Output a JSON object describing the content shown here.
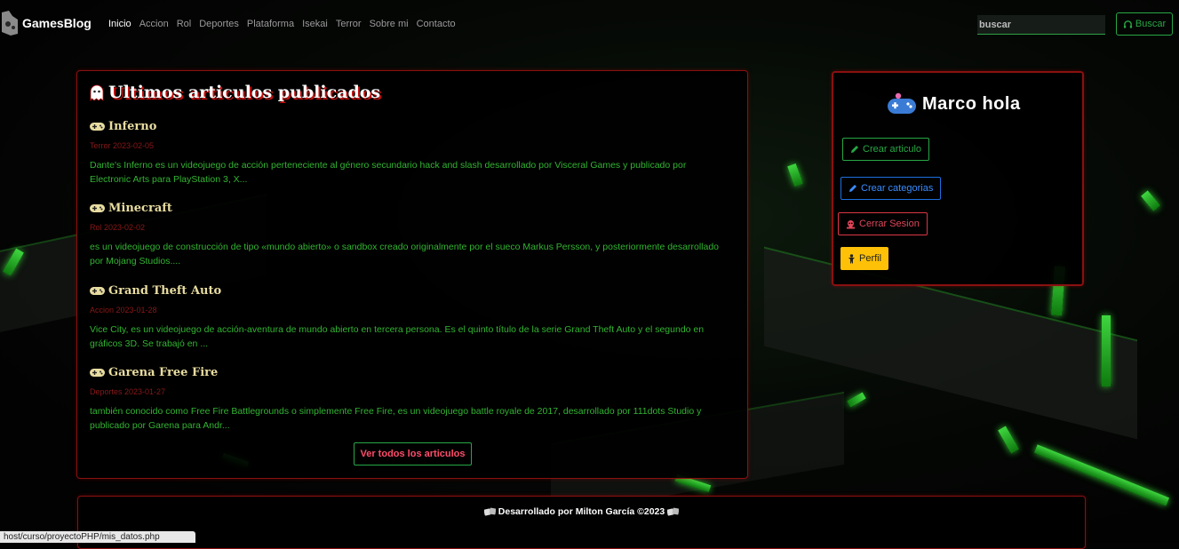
{
  "nav": {
    "brand": "GamesBlog",
    "items": [
      {
        "label": "Inicio",
        "active": true
      },
      {
        "label": "Accion"
      },
      {
        "label": "Rol"
      },
      {
        "label": "Deportes"
      },
      {
        "label": "Plataforma"
      },
      {
        "label": "Isekai"
      },
      {
        "label": "Terror"
      },
      {
        "label": "Sobre mi"
      },
      {
        "label": "Contacto"
      }
    ],
    "search_placeholder": "buscar",
    "search_button": "Buscar"
  },
  "main": {
    "title": "Ultimos articulos publicados",
    "articles": [
      {
        "title": "Inferno",
        "meta": "Terror 2023-02-05",
        "excerpt": "Dante's Inferno es un videojuego de acción perteneciente al género secundario hack and slash desarrollado por Visceral Games y publicado por Electronic Arts para PlayStation 3, X..."
      },
      {
        "title": "Minecraft",
        "meta": "Rol 2023-02-02",
        "excerpt": "es un videojuego de construcción de tipo «mundo abierto» o sandbox creado originalmente por el sueco Markus Persson,  y posteriormente desarrollado por Mojang Studios...."
      },
      {
        "title": "Grand Theft Auto",
        "meta": "Accion 2023-01-28",
        "excerpt": "Vice City, es un videojuego de acción-aventura de mundo abierto en tercera persona. Es el quinto título de la serie Grand Theft Auto y el segundo en gráficos 3D. Se trabajó en ..."
      },
      {
        "title": "Garena Free Fire",
        "meta": "Deportes 2023-01-27",
        "excerpt": "también conocido como Free Fire Battlegrounds o simplemente Free Fire, es un videojuego battle royale de 2017, desarrollado por 111dots Studio y publicado por Garena para Andr..."
      }
    ],
    "all_button": "Ver todos los articulos"
  },
  "sidebar": {
    "user": "Marco hola",
    "create_article": "Crear articulo",
    "create_categories": "Crear categorias",
    "logout": "Cerrar Sesion",
    "profile": "Perfil"
  },
  "footer": {
    "text": "Desarrollado por Milton García ©2023"
  },
  "statusbar": {
    "url": "host/curso/proyectoPHP/mis_datos.php"
  },
  "colors": {
    "accent_green": "#28a745",
    "panel_border": "#8a1010",
    "excerpt_text": "#32b432"
  }
}
